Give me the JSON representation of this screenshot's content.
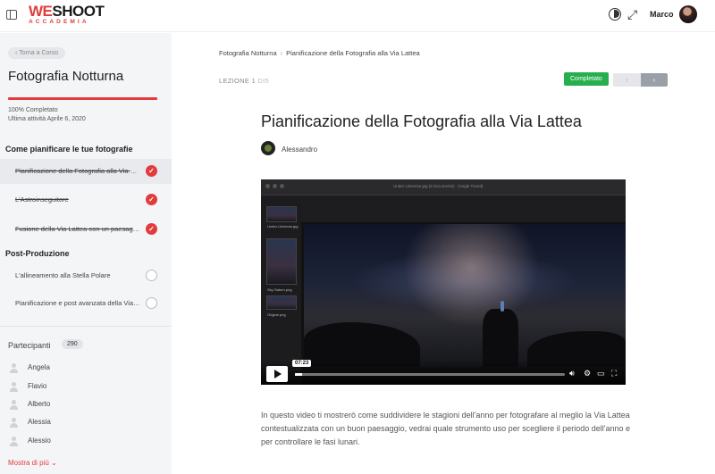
{
  "header": {
    "logo_text_a": "WE",
    "logo_text_b": "SHOOT",
    "logo_sub": "ACCADEMIA",
    "user_name": "Marco"
  },
  "sidebar": {
    "back_label": "‹ Torna a Corso",
    "course_title": "Fotografia Notturna",
    "progress_percent": 100,
    "progress_label": "100% Completato",
    "last_activity": "Ultima attività Aprile 6, 2020",
    "sections": [
      {
        "title": "Come pianificare le tue fotografie",
        "lessons": [
          {
            "label": "Pianificazione della Fotografia alla Via Lattea",
            "done": true,
            "active": true
          },
          {
            "label": "L'Astroinseguitore",
            "done": true,
            "active": false
          },
          {
            "label": "Fusione della Via Lattea con un paesaggio",
            "done": true,
            "active": false
          }
        ]
      },
      {
        "title": "Post-Produzione",
        "lessons": [
          {
            "label": "L'allineamento alla Stella Polare",
            "done": false,
            "active": false
          },
          {
            "label": "Pianificazione e post avanzata della Via Lattea",
            "done": false,
            "active": false
          }
        ]
      }
    ],
    "participants_title": "Partecipanti",
    "participants_count": "290",
    "participants": [
      "Angela",
      "Flavio",
      "Alberto",
      "Alessia",
      "Alessio"
    ],
    "show_more": "Mostra di più ⌄"
  },
  "main": {
    "breadcrumb": [
      "Fotografia Notturna",
      "Pianificazione della Fotografia alla Via Lattea"
    ],
    "lesson_label": "LEZIONE 1",
    "lesson_of": "DI5",
    "completed_label": "Completato",
    "prev_label": "‹",
    "next_label": "›",
    "title": "Pianificazione della Fotografia alla Via Lattea",
    "author": "Alessandro",
    "video": {
      "time": "07:23",
      "filename": "Under Universe.jpg (8 documents) · [Angle Tuned]",
      "thumbnails": [
        "Under-Universe.jpg",
        "Sky-Saturn.png",
        "Origine.png"
      ]
    },
    "description": "In questo video ti mostrerò come suddividere le stagioni dell'anno per fotografare al meglio la Via Lattea contestualizzata con un buon paesaggio, vedrai quale strumento uso per scegliere il periodo dell'anno e per controllare le fasi lunari."
  },
  "colors": {
    "brand": "#e23b3b",
    "success": "#27ae4f"
  }
}
